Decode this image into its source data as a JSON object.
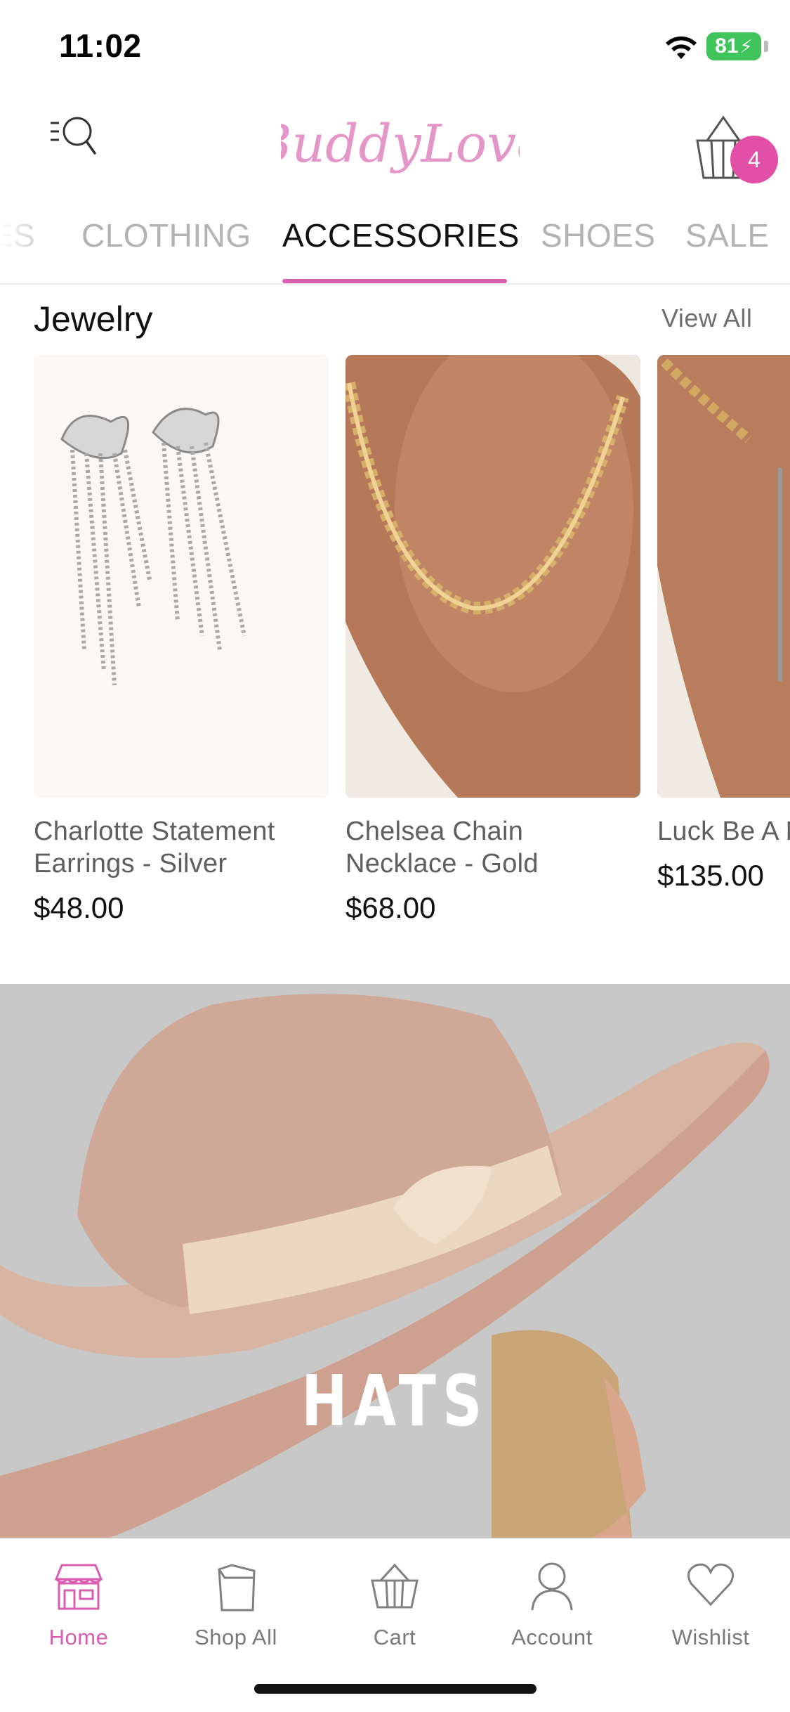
{
  "status_bar": {
    "time": "11:02",
    "battery": "81"
  },
  "header": {
    "logo_text": "BuddyLove",
    "cart_count": "4",
    "icons": {
      "menu": "menu-search-icon",
      "cart": "basket-icon"
    }
  },
  "tabs": [
    {
      "label": "ES"
    },
    {
      "label": "CLOTHING"
    },
    {
      "label": "ACCESSORIES"
    },
    {
      "label": "SHOES"
    },
    {
      "label": "SALE"
    }
  ],
  "active_tab": "ACCESSORIES",
  "jewelry": {
    "title": "Jewelry",
    "view_all": "View All",
    "products": [
      {
        "name": "Charlotte Statement Earrings - Silver",
        "price": "$48.00"
      },
      {
        "name": "Chelsea Chain Necklace - Gold",
        "price": "$68.00"
      },
      {
        "name": "Luck Be A Necklace -",
        "price": "$135.00"
      }
    ]
  },
  "banner": {
    "title": "HATS"
  },
  "bottom_nav": [
    {
      "label": "Home",
      "icon": "storefront-icon",
      "active": true
    },
    {
      "label": "Shop All",
      "icon": "shopping-bag-icon",
      "active": false
    },
    {
      "label": "Cart",
      "icon": "basket-icon",
      "active": false
    },
    {
      "label": "Account",
      "icon": "user-icon",
      "active": false
    },
    {
      "label": "Wishlist",
      "icon": "heart-icon",
      "active": false
    }
  ],
  "colors": {
    "accent": "#d85fb0",
    "badge": "#e24fa7",
    "battery": "#3fc45c"
  }
}
